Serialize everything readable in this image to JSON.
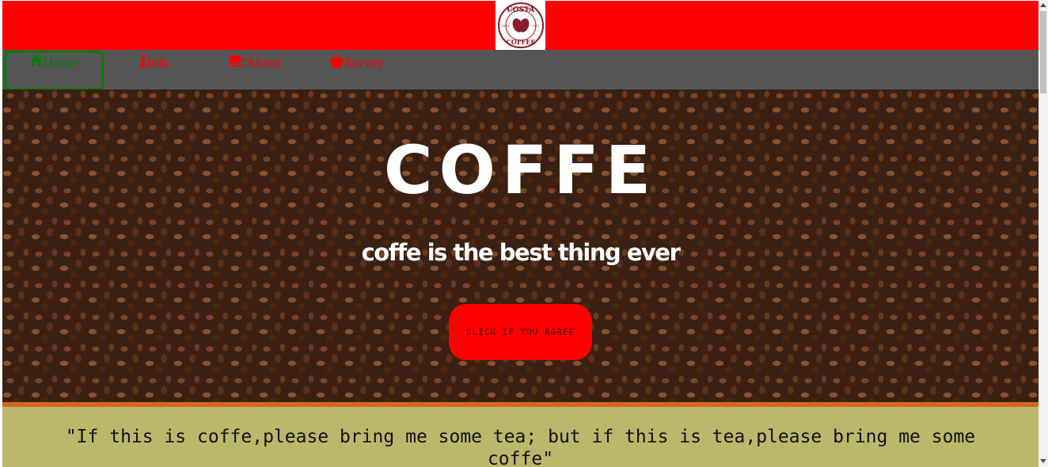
{
  "header": {
    "logo_top": "COSTA",
    "logo_bottom": "COFFEE",
    "logo_since": "SINCE",
    "logo_year": "1971",
    "bar_color": "#ff0000"
  },
  "nav": {
    "items": [
      {
        "label": "Home",
        "icon": "home-icon",
        "active": true
      },
      {
        "label": "Info",
        "icon": "info-icon"
      },
      {
        "label": "About",
        "icon": "coffee-cup-icon"
      },
      {
        "label": "Survey",
        "icon": "apple-icon"
      }
    ],
    "background": "#555555",
    "link_color": "#ff0000",
    "active_color": "#0a7a0a"
  },
  "hero": {
    "title": "COFFE",
    "subtitle": "coffe is the best thing ever",
    "button_label": "CLICK IF YOU AGREE",
    "button_color": "#ff0000"
  },
  "quote": {
    "text": "\"If this is coffe,please bring me some tea; but if this is tea,please bring me some coffe\"",
    "background": "#bdb76b",
    "divider_color": "#d2691e"
  }
}
